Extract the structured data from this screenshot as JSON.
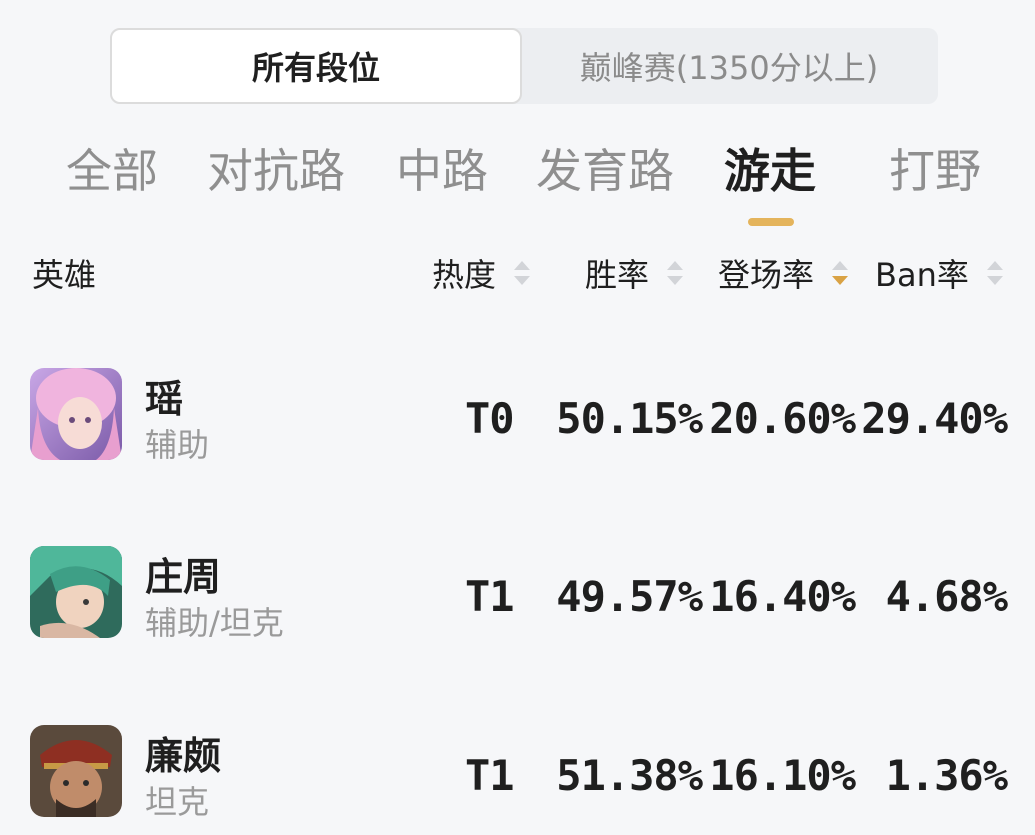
{
  "segments": {
    "all_ranks": "所有段位",
    "peak": "巅峰赛(1350分以上)"
  },
  "tabs": [
    "全部",
    "对抗路",
    "中路",
    "发育路",
    "游走",
    "打野"
  ],
  "active_tab": "游走",
  "columns": {
    "hero": "英雄",
    "heat": "热度",
    "win_rate": "胜率",
    "pick_rate": "登场率",
    "ban_rate": "Ban率"
  },
  "sorted_column": "登场率",
  "sort_direction": "descending",
  "colors": {
    "accent": "#e4b45c",
    "sort_active": "#d9a244"
  },
  "heroes": [
    {
      "name": "瑶",
      "role": "辅助",
      "tier": "T0",
      "win_rate": "50.15%",
      "pick_rate": "20.60%",
      "ban_rate": "29.40%"
    },
    {
      "name": "庄周",
      "role": "辅助/坦克",
      "tier": "T1",
      "win_rate": "49.57%",
      "pick_rate": "16.40%",
      "ban_rate": "4.68%"
    },
    {
      "name": "廉颇",
      "role": "坦克",
      "tier": "T1",
      "win_rate": "51.38%",
      "pick_rate": "16.10%",
      "ban_rate": "1.36%"
    }
  ]
}
